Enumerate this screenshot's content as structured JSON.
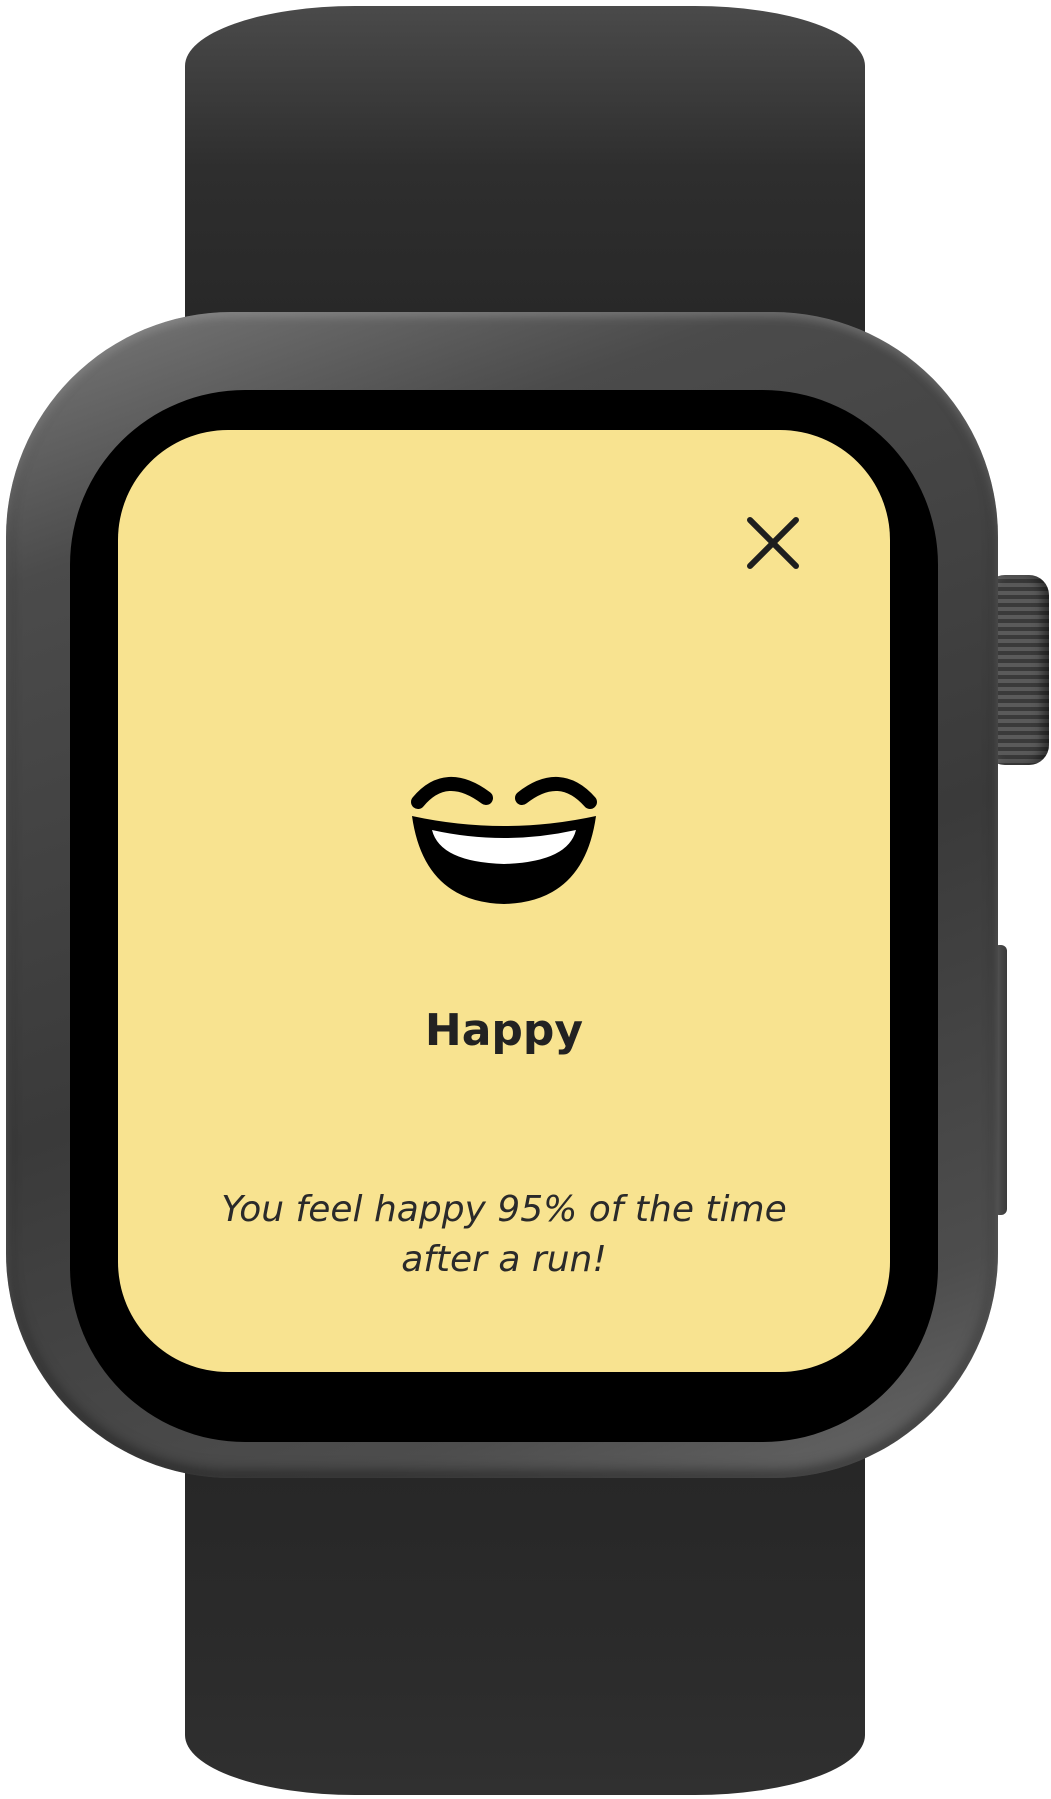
{
  "device": {
    "type": "smartwatch",
    "screen_color": "#f8e390"
  },
  "mood_card": {
    "close_icon": "close-icon",
    "emoji_icon": "grinning-face-with-closed-eyes-icon",
    "title": "Happy",
    "message_line1": "You feel happy 95% of the time",
    "message_line2": "after a run!"
  }
}
